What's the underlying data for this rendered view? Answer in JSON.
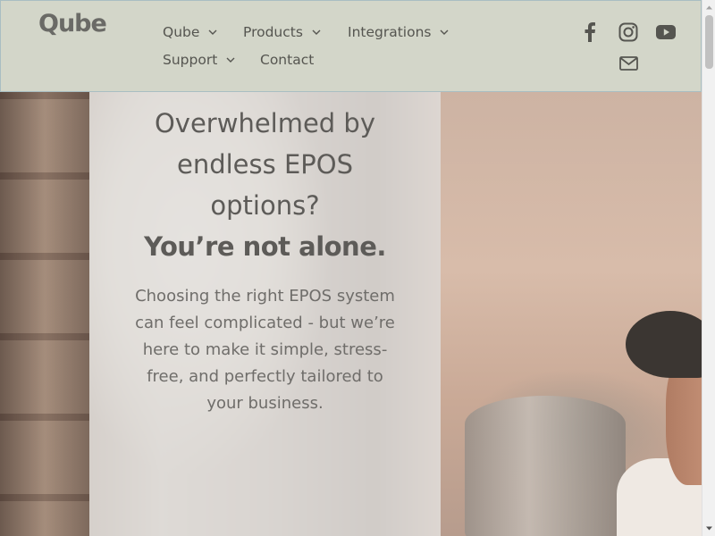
{
  "brand": {
    "logo_text": "Qube"
  },
  "nav": {
    "items": [
      {
        "label": "Qube",
        "has_dropdown": true
      },
      {
        "label": "Products",
        "has_dropdown": true
      },
      {
        "label": "Integrations",
        "has_dropdown": true
      },
      {
        "label": "Support",
        "has_dropdown": true
      },
      {
        "label": "Contact",
        "has_dropdown": false
      }
    ]
  },
  "social": [
    "facebook-icon",
    "instagram-icon",
    "youtube-icon",
    "mail-icon"
  ],
  "hero": {
    "heading_lines": [
      "Overwhelmed by",
      "endless EPOS",
      "options?"
    ],
    "heading_emphasis": "You’re not alone.",
    "body": "Choosing the right EPOS system can feel complicated - but we’re here to make it simple, stress-free, and perfectly tailored to your business."
  },
  "colors": {
    "header_bg": "#d3d6c9",
    "header_border": "#a9bec2",
    "text_dark": "#555550",
    "panel_overlay": "#e1dfdc"
  }
}
